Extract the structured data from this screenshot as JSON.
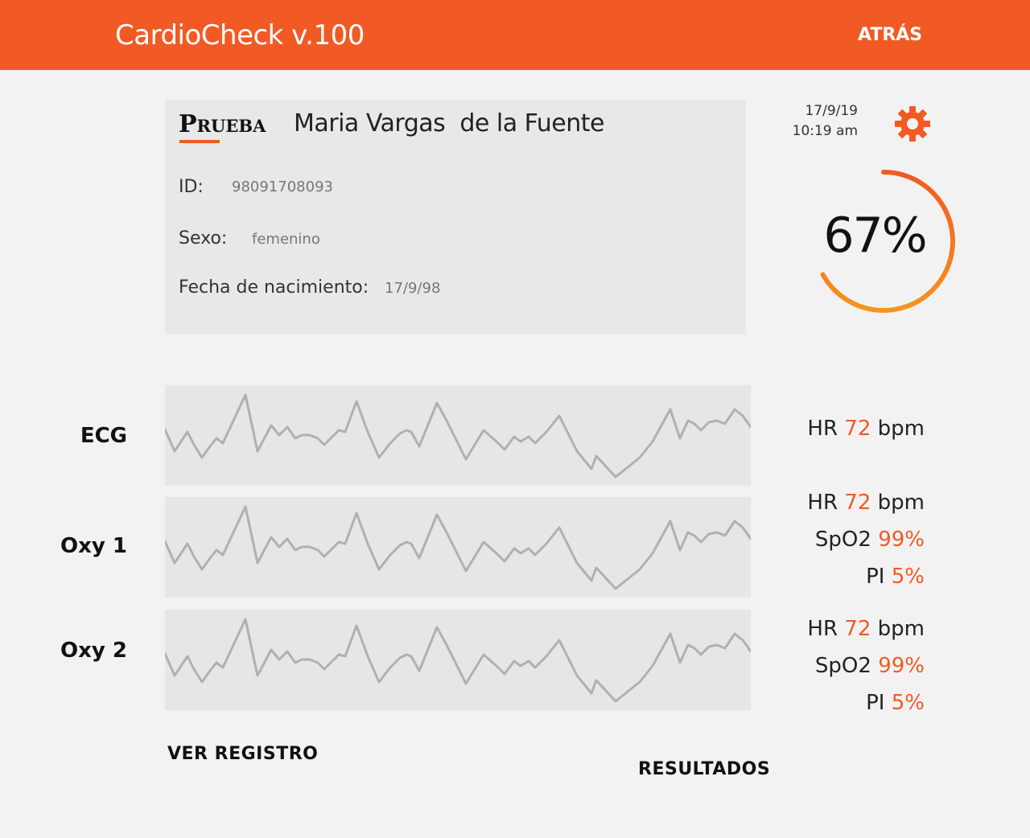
{
  "header": {
    "app_title": "CardioCheck v.100",
    "back_label": "ATRÁS"
  },
  "patient": {
    "test_label": "Prueba",
    "name": "Maria Vargas  de la Fuente",
    "id_label": "ID:",
    "id_value": "98091708093",
    "sex_label": "Sexo:",
    "sex_value": "femenino",
    "birth_label": "Fecha de nacimiento:",
    "birth_value": "17/9/98"
  },
  "status": {
    "date": "17/9/19",
    "time": "10:19 am",
    "progress_label": "67%",
    "progress_fraction": 0.67
  },
  "channels": [
    {
      "name": "ECG",
      "metrics": [
        {
          "label": "HR",
          "value": "72",
          "unit": "bpm"
        }
      ]
    },
    {
      "name": "Oxy 1",
      "metrics": [
        {
          "label": "HR",
          "value": "72",
          "unit": "bpm"
        },
        {
          "label": "SpO2",
          "value": "99%",
          "unit": ""
        },
        {
          "label": "PI",
          "value": "5%",
          "unit": ""
        }
      ]
    },
    {
      "name": "Oxy 2",
      "metrics": [
        {
          "label": "HR",
          "value": "72",
          "unit": "bpm"
        },
        {
          "label": "SpO2",
          "value": "99%",
          "unit": ""
        },
        {
          "label": "PI",
          "value": "5%",
          "unit": ""
        }
      ]
    }
  ],
  "actions": {
    "view_log": "VER REGISTRO",
    "results": "RESULTADOS"
  },
  "colors": {
    "accent": "#f15a24",
    "accent_light": "#f7931e",
    "wave": "#b0b0b0"
  },
  "icons": {
    "settings": "gear-icon"
  }
}
